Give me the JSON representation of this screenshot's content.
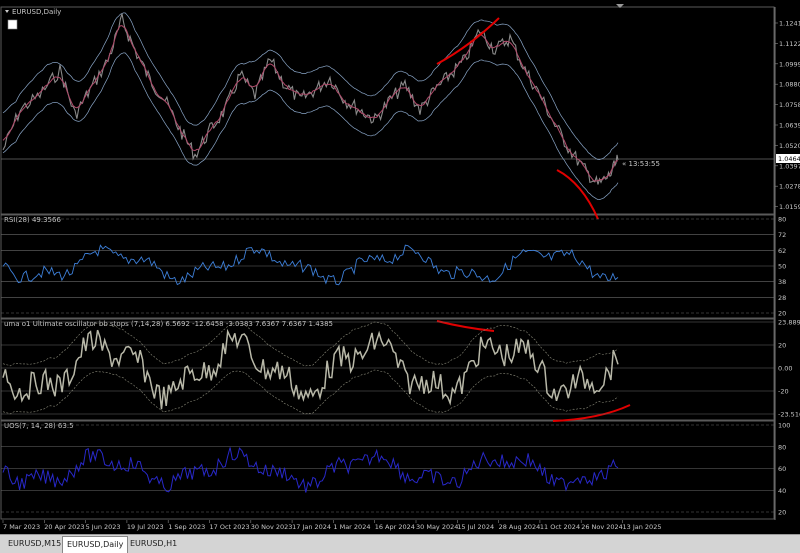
{
  "window": {
    "symbol_title": "EURUSD,Daily"
  },
  "timer": "« 13:53:55",
  "price_axis": {
    "ticks": [
      "1.12410",
      "1.11220",
      "1.09995",
      "1.08800",
      "1.07580",
      "1.06390",
      "1.05200",
      "1.03975",
      "1.02785",
      "1.01595"
    ],
    "current_price": "1.04649"
  },
  "panels": {
    "rsi": {
      "title": "RSI(28) 49.3566",
      "levels": [
        "80",
        "72",
        "62",
        "50",
        "38",
        "28",
        "20"
      ]
    },
    "uma": {
      "title": "uma o1 Ultimate oscillator bb stops (7,14,28) 6.5692 -12.6458 -3.0383 7.6367 7.6367 1.4385",
      "levels": [
        "23.8892",
        "20",
        "0.00",
        "-20",
        "-23.5162"
      ]
    },
    "uos": {
      "title": "UOS(7, 14, 28) 63.5",
      "levels": [
        "100",
        "80",
        "60",
        "40",
        "20"
      ]
    }
  },
  "time_axis": [
    "7 Mar 2023",
    "20 Apr 2023",
    "5 Jun 2023",
    "19 Jul 2023",
    "1 Sep 2023",
    "17 Oct 2023",
    "30 Nov 2023",
    "17 Jan 2024",
    "1 Mar 2024",
    "16 Apr 2024",
    "30 May 2024",
    "15 Jul 2024",
    "28 Aug 2024",
    "11 Oct 2024",
    "26 Nov 2024",
    "13 Jan 2025"
  ],
  "tabs": [
    {
      "label": "EURUSD,M15",
      "active": false
    },
    {
      "label": "EURUSD,Daily",
      "active": true
    },
    {
      "label": "EURUSD,H1",
      "active": false
    }
  ],
  "colors": {
    "price": "#8a8a8a",
    "ma": "#b04a6a",
    "bands": "#8aa6c8",
    "rsi": "#3d7fd8",
    "uma": "#b8b8a8",
    "uos": "#2828c8",
    "annotation": "#e00000"
  }
}
